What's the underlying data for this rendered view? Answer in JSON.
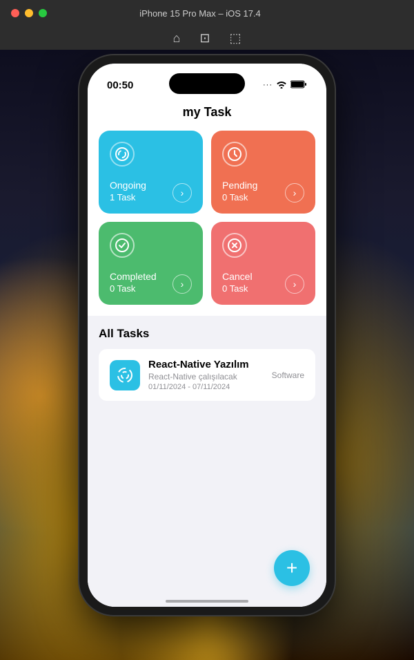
{
  "titlebar": {
    "title": "iPhone 15 Pro Max – iOS 17.4",
    "icons": [
      "home",
      "camera",
      "share"
    ]
  },
  "status_bar": {
    "time": "00:50"
  },
  "app": {
    "title": "my Task",
    "cards": [
      {
        "id": "ongoing",
        "label": "Ongoing",
        "count": "1 Task",
        "icon": "↻",
        "color_class": "card-ongoing"
      },
      {
        "id": "pending",
        "label": "Pending",
        "count": "0 Task",
        "icon": "◷",
        "color_class": "card-pending"
      },
      {
        "id": "completed",
        "label": "Completed",
        "count": "0 Task",
        "icon": "✓",
        "color_class": "card-completed"
      },
      {
        "id": "cancel",
        "label": "Cancel",
        "count": "0 Task",
        "icon": "✕",
        "color_class": "card-cancel"
      }
    ],
    "all_tasks_header": "All Tasks",
    "tasks": [
      {
        "name": "React-Native Yazılım",
        "description": "React-Native çalışılacak",
        "dates": "01/11/2024 - 07/11/2024",
        "category": "Software"
      }
    ],
    "fab_label": "+"
  }
}
